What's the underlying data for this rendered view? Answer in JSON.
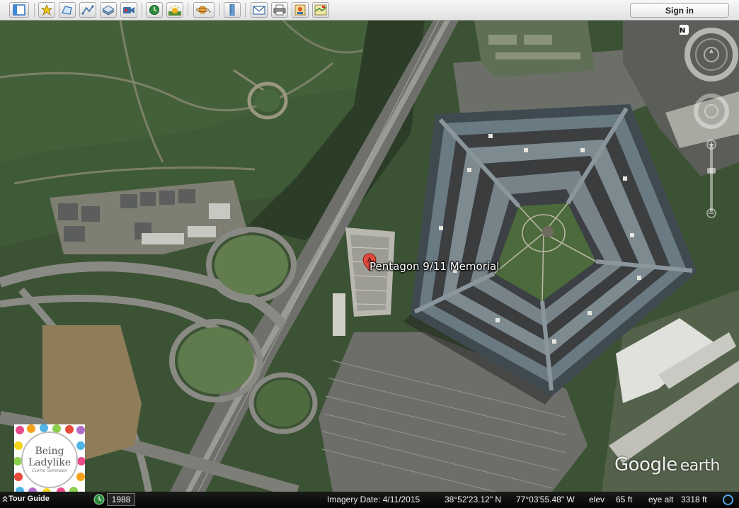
{
  "toolbar": {
    "sign_in_label": "Sign in",
    "buttons": [
      {
        "icon": "sidebar-toggle-icon"
      },
      {
        "icon": "add-placemark-icon"
      },
      {
        "icon": "add-polygon-icon"
      },
      {
        "icon": "add-path-icon"
      },
      {
        "icon": "add-image-overlay-icon"
      },
      {
        "icon": "record-tour-icon"
      },
      {
        "icon": "historical-imagery-icon"
      },
      {
        "icon": "sunlight-icon"
      },
      {
        "icon": "planets-icon"
      },
      {
        "icon": "ruler-icon"
      },
      {
        "icon": "email-icon"
      },
      {
        "icon": "print-icon"
      },
      {
        "icon": "save-image-icon"
      },
      {
        "icon": "view-in-maps-icon"
      }
    ]
  },
  "map": {
    "placemark": {
      "marker_letter": "A",
      "label": "Pentagon 9/11 Memorial"
    },
    "compass_letter": "N",
    "brand": {
      "main": "Google",
      "sub": "earth"
    },
    "badge": {
      "line1": "Being",
      "line2": "Ladylike",
      "signature": "Carrie Sorensen"
    }
  },
  "status": {
    "tour_guide": "Tour Guide",
    "historical_year": "1988",
    "imagery_date": "Imagery Date: 4/11/2015",
    "lat": "38°52'23.12\" N",
    "lon": "77°03'55.48\" W",
    "elev_label": "elev",
    "elev_value": "65 ft",
    "eye_alt_label": "eye alt",
    "eye_alt_value": "3318 ft"
  },
  "colors": {
    "toolbar_bg": "#e8e8e8",
    "status_bg": "#111111",
    "placemark_red": "#e04a3c",
    "nav_ring": "#ffffff"
  }
}
